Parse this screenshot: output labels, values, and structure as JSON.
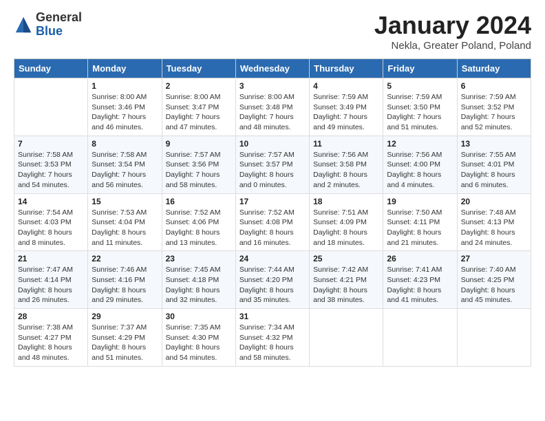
{
  "header": {
    "logo_general": "General",
    "logo_blue": "Blue",
    "month_title": "January 2024",
    "location": "Nekla, Greater Poland, Poland"
  },
  "days_of_week": [
    "Sunday",
    "Monday",
    "Tuesday",
    "Wednesday",
    "Thursday",
    "Friday",
    "Saturday"
  ],
  "weeks": [
    [
      {
        "day": "",
        "info": ""
      },
      {
        "day": "1",
        "info": "Sunrise: 8:00 AM\nSunset: 3:46 PM\nDaylight: 7 hours\nand 46 minutes."
      },
      {
        "day": "2",
        "info": "Sunrise: 8:00 AM\nSunset: 3:47 PM\nDaylight: 7 hours\nand 47 minutes."
      },
      {
        "day": "3",
        "info": "Sunrise: 8:00 AM\nSunset: 3:48 PM\nDaylight: 7 hours\nand 48 minutes."
      },
      {
        "day": "4",
        "info": "Sunrise: 7:59 AM\nSunset: 3:49 PM\nDaylight: 7 hours\nand 49 minutes."
      },
      {
        "day": "5",
        "info": "Sunrise: 7:59 AM\nSunset: 3:50 PM\nDaylight: 7 hours\nand 51 minutes."
      },
      {
        "day": "6",
        "info": "Sunrise: 7:59 AM\nSunset: 3:52 PM\nDaylight: 7 hours\nand 52 minutes."
      }
    ],
    [
      {
        "day": "7",
        "info": "Sunrise: 7:58 AM\nSunset: 3:53 PM\nDaylight: 7 hours\nand 54 minutes."
      },
      {
        "day": "8",
        "info": "Sunrise: 7:58 AM\nSunset: 3:54 PM\nDaylight: 7 hours\nand 56 minutes."
      },
      {
        "day": "9",
        "info": "Sunrise: 7:57 AM\nSunset: 3:56 PM\nDaylight: 7 hours\nand 58 minutes."
      },
      {
        "day": "10",
        "info": "Sunrise: 7:57 AM\nSunset: 3:57 PM\nDaylight: 8 hours\nand 0 minutes."
      },
      {
        "day": "11",
        "info": "Sunrise: 7:56 AM\nSunset: 3:58 PM\nDaylight: 8 hours\nand 2 minutes."
      },
      {
        "day": "12",
        "info": "Sunrise: 7:56 AM\nSunset: 4:00 PM\nDaylight: 8 hours\nand 4 minutes."
      },
      {
        "day": "13",
        "info": "Sunrise: 7:55 AM\nSunset: 4:01 PM\nDaylight: 8 hours\nand 6 minutes."
      }
    ],
    [
      {
        "day": "14",
        "info": "Sunrise: 7:54 AM\nSunset: 4:03 PM\nDaylight: 8 hours\nand 8 minutes."
      },
      {
        "day": "15",
        "info": "Sunrise: 7:53 AM\nSunset: 4:04 PM\nDaylight: 8 hours\nand 11 minutes."
      },
      {
        "day": "16",
        "info": "Sunrise: 7:52 AM\nSunset: 4:06 PM\nDaylight: 8 hours\nand 13 minutes."
      },
      {
        "day": "17",
        "info": "Sunrise: 7:52 AM\nSunset: 4:08 PM\nDaylight: 8 hours\nand 16 minutes."
      },
      {
        "day": "18",
        "info": "Sunrise: 7:51 AM\nSunset: 4:09 PM\nDaylight: 8 hours\nand 18 minutes."
      },
      {
        "day": "19",
        "info": "Sunrise: 7:50 AM\nSunset: 4:11 PM\nDaylight: 8 hours\nand 21 minutes."
      },
      {
        "day": "20",
        "info": "Sunrise: 7:48 AM\nSunset: 4:13 PM\nDaylight: 8 hours\nand 24 minutes."
      }
    ],
    [
      {
        "day": "21",
        "info": "Sunrise: 7:47 AM\nSunset: 4:14 PM\nDaylight: 8 hours\nand 26 minutes."
      },
      {
        "day": "22",
        "info": "Sunrise: 7:46 AM\nSunset: 4:16 PM\nDaylight: 8 hours\nand 29 minutes."
      },
      {
        "day": "23",
        "info": "Sunrise: 7:45 AM\nSunset: 4:18 PM\nDaylight: 8 hours\nand 32 minutes."
      },
      {
        "day": "24",
        "info": "Sunrise: 7:44 AM\nSunset: 4:20 PM\nDaylight: 8 hours\nand 35 minutes."
      },
      {
        "day": "25",
        "info": "Sunrise: 7:42 AM\nSunset: 4:21 PM\nDaylight: 8 hours\nand 38 minutes."
      },
      {
        "day": "26",
        "info": "Sunrise: 7:41 AM\nSunset: 4:23 PM\nDaylight: 8 hours\nand 41 minutes."
      },
      {
        "day": "27",
        "info": "Sunrise: 7:40 AM\nSunset: 4:25 PM\nDaylight: 8 hours\nand 45 minutes."
      }
    ],
    [
      {
        "day": "28",
        "info": "Sunrise: 7:38 AM\nSunset: 4:27 PM\nDaylight: 8 hours\nand 48 minutes."
      },
      {
        "day": "29",
        "info": "Sunrise: 7:37 AM\nSunset: 4:29 PM\nDaylight: 8 hours\nand 51 minutes."
      },
      {
        "day": "30",
        "info": "Sunrise: 7:35 AM\nSunset: 4:30 PM\nDaylight: 8 hours\nand 54 minutes."
      },
      {
        "day": "31",
        "info": "Sunrise: 7:34 AM\nSunset: 4:32 PM\nDaylight: 8 hours\nand 58 minutes."
      },
      {
        "day": "",
        "info": ""
      },
      {
        "day": "",
        "info": ""
      },
      {
        "day": "",
        "info": ""
      }
    ]
  ]
}
